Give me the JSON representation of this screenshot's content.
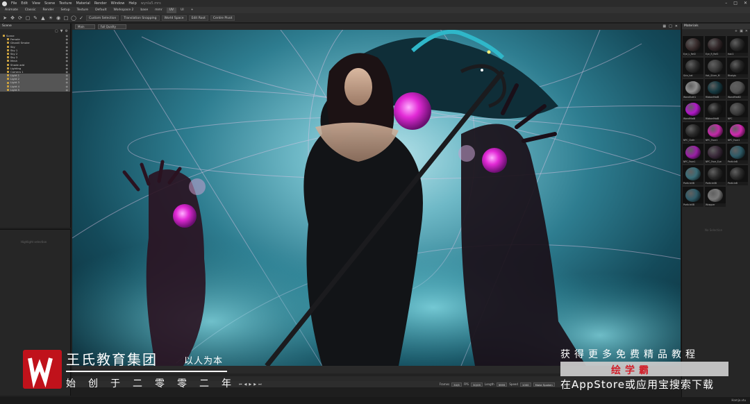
{
  "menubar": {
    "items": [
      "File",
      "Edit",
      "View",
      "Scene",
      "Texture",
      "Material",
      "Render",
      "Window",
      "Help"
    ],
    "doc_title": "wynla5.mrs"
  },
  "tabs": [
    {
      "label": "Animate",
      "active": false
    },
    {
      "label": "Classic",
      "active": false
    },
    {
      "label": "Render",
      "active": false
    },
    {
      "label": "Setup",
      "active": false
    },
    {
      "label": "Texture",
      "active": false
    },
    {
      "label": "Default",
      "active": false
    },
    {
      "label": "Workspace 2",
      "active": false
    },
    {
      "label": "base",
      "active": false
    },
    {
      "label": "mmr",
      "active": false
    },
    {
      "label": "UV",
      "active": true
    },
    {
      "label": "UI",
      "active": false
    },
    {
      "label": "+",
      "active": false
    }
  ],
  "toolbar": {
    "buttons": [
      "Custom Selection",
      "Translation Snapping",
      "World Space",
      "Edit Root",
      "Centre Pivot"
    ]
  },
  "scene_panel": {
    "title": "Scene",
    "items": [
      {
        "label": "Scene",
        "indent": 0,
        "selected": false
      },
      {
        "label": "Female",
        "indent": 1,
        "selected": false
      },
      {
        "label": "Ghost0 Smoke",
        "indent": 1,
        "selected": false
      },
      {
        "label": "Sky",
        "indent": 1,
        "selected": false
      },
      {
        "label": "Sky 1",
        "indent": 1,
        "selected": false
      },
      {
        "label": "Sky 2",
        "indent": 1,
        "selected": false
      },
      {
        "label": "Sky 3",
        "indent": 1,
        "selected": false
      },
      {
        "label": "Mesh",
        "indent": 1,
        "selected": false
      },
      {
        "label": "Shade add",
        "indent": 1,
        "selected": false
      },
      {
        "label": "Lighting",
        "indent": 1,
        "selected": false
      },
      {
        "label": "Camera 1",
        "indent": 1,
        "selected": false
      },
      {
        "label": "Light 1",
        "indent": 1,
        "selected": true
      },
      {
        "label": "Light 2",
        "indent": 1,
        "selected": true
      },
      {
        "label": "Light 3",
        "indent": 1,
        "selected": true
      },
      {
        "label": "Light 4",
        "indent": 1,
        "selected": true
      },
      {
        "label": "Light 5",
        "indent": 1,
        "selected": true
      }
    ]
  },
  "properties_panel": {
    "empty_text": "Highlight selection"
  },
  "viewport": {
    "view_select": "Main",
    "quality_select": "Full Quality"
  },
  "materials_panel": {
    "title": "Materials",
    "items": [
      {
        "label": "Eye_L_Ref2",
        "color": "#3a2e2e"
      },
      {
        "label": "Eye_R_Ref2",
        "color": "#33282a"
      },
      {
        "label": "Hair2",
        "color": "#2a2a2a"
      },
      {
        "label": "Skin_hat",
        "color": "#2c2c2c"
      },
      {
        "label": "Hat_Silver_M",
        "color": "#3b3b3b"
      },
      {
        "label": "Rhatgls",
        "color": "#262626"
      },
      {
        "label": "Wand0ut01",
        "color": "#8e8e8e"
      },
      {
        "label": "RibbonMatB",
        "color": "#173a42"
      },
      {
        "label": "WandMatB2",
        "color": "#555555"
      },
      {
        "label": "WandMatB",
        "color": "#b018c8"
      },
      {
        "label": "RibbonMatB",
        "color": "#1e1e1e"
      },
      {
        "label": "NPC",
        "color": "#3e3e3e"
      },
      {
        "label": "NPC_Cloth",
        "color": "#2a2a2a"
      },
      {
        "label": "NPC_Face1",
        "color": "#c22aa8"
      },
      {
        "label": "NPC_Face1",
        "color": "#d02ab0"
      },
      {
        "label": "NPC_Face1",
        "color": "#9a1fa6"
      },
      {
        "label": "NPC_Face_Eye",
        "color": "#3a2a3a"
      },
      {
        "label": "ParticleB",
        "color": "#2e5a66"
      },
      {
        "label": "Particle0B",
        "color": "#3a6d78"
      },
      {
        "label": "Particle0B",
        "color": "#2a2a2a"
      },
      {
        "label": "ParticleB",
        "color": "#2b2b2b"
      },
      {
        "label": "Particle0B",
        "color": "#2f5b68"
      },
      {
        "label": "Wrapper",
        "color": "#7a7a7a"
      }
    ],
    "empty_text": "No Selection"
  },
  "playbar": {
    "frame_label": "Frames",
    "frame_value": "30/9",
    "fps_label": "FPS",
    "fps_value": "30/09",
    "length_label": "Length",
    "length_value": "9999",
    "speed_label": "Speed",
    "speed_value": "1000",
    "mode": "Make Spoken"
  },
  "status_bar": {
    "text": "Hamja.vtu"
  },
  "overlay": {
    "brand_name": "王氏教育集团",
    "brand_slogan": "以人为本",
    "brand_year": "始创于二零零二年",
    "promo_line1": "获得更多免费精品教程",
    "promo_brand": "绘学霸",
    "promo_line2": "在AppStore或应用宝搜索下载",
    "accent_color": "#c0121b"
  }
}
